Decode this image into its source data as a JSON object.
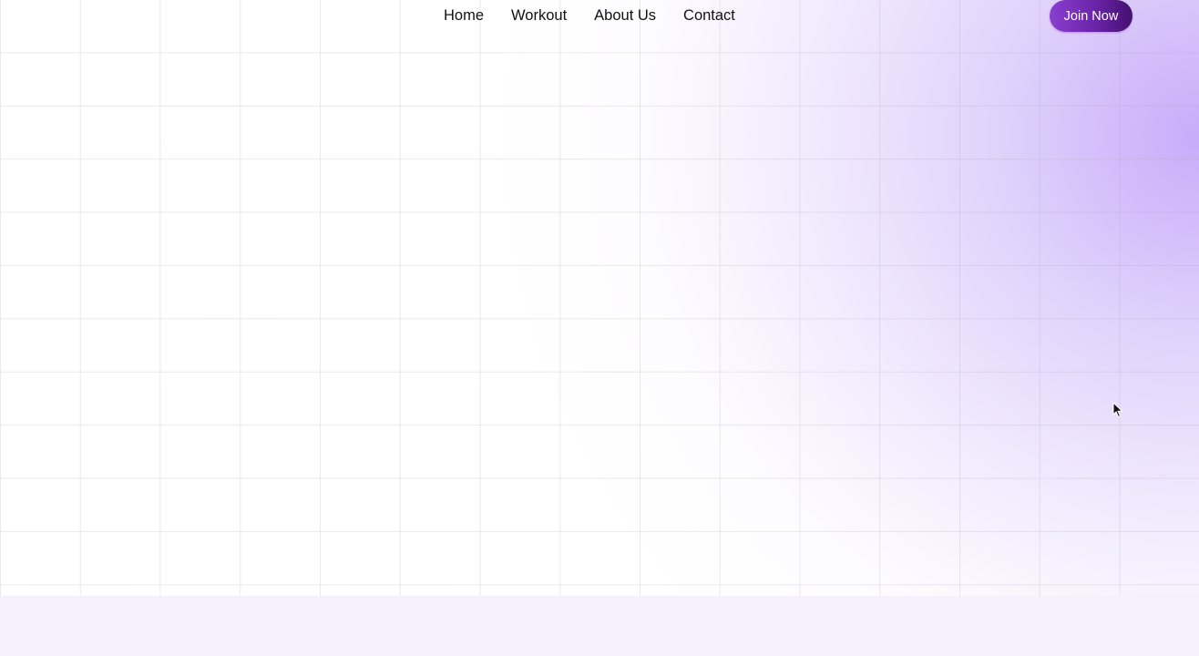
{
  "nav": {
    "items": [
      {
        "label": "Home"
      },
      {
        "label": "Workout"
      },
      {
        "label": "About Us"
      },
      {
        "label": "Contact"
      }
    ],
    "cta_label": "Join Now"
  },
  "colors": {
    "accent": "#7a30c0",
    "accent_dark": "#451070",
    "glow": "#c4a8fa",
    "band": "#f6f0fd"
  },
  "icons": {
    "pointer": "mouse-pointer-icon"
  }
}
